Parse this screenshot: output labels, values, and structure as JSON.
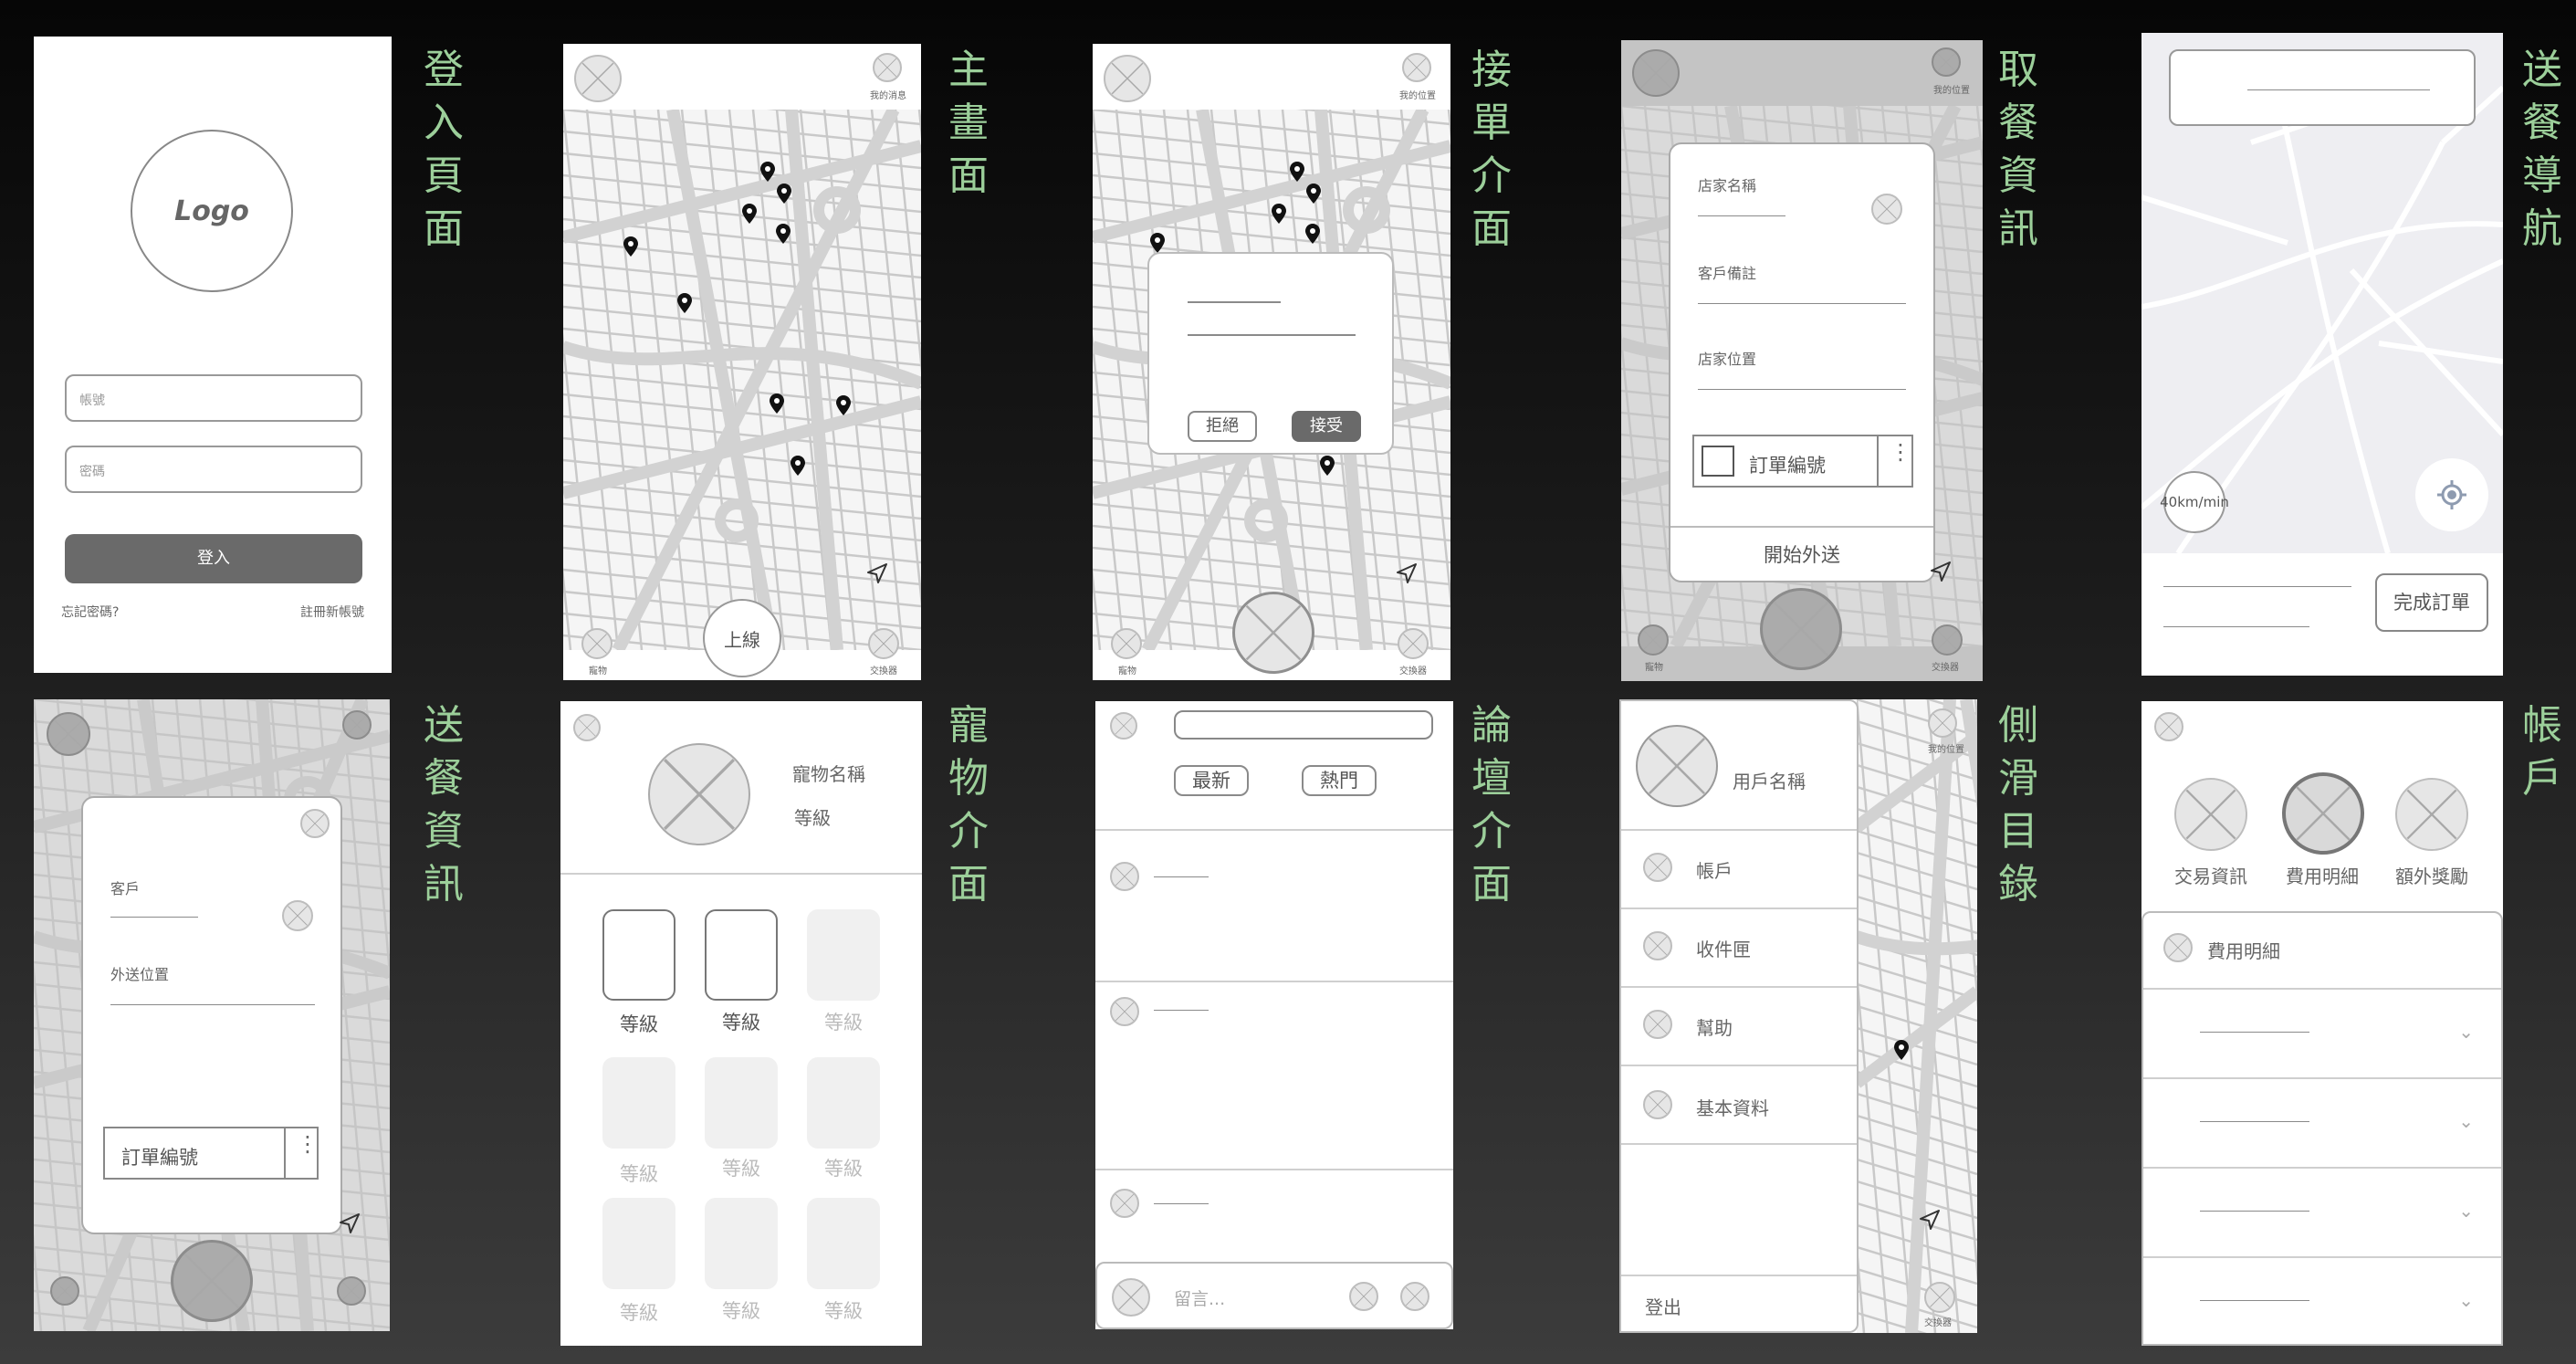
{
  "titles": {
    "login": "登入頁面",
    "main": "主畫面",
    "accept": "接單介面",
    "pickup": "取餐資訊",
    "nav": "送餐導航",
    "delivery": "送餐資訊",
    "pet": "寵物介面",
    "forum": "論壇介面",
    "sidebar": "側滑目錄",
    "account": "帳戶"
  },
  "login": {
    "logo": "Logo",
    "account_placeholder": "帳號",
    "password_placeholder": "密碼",
    "login_button": "登入",
    "forgot": "忘記密碼?",
    "register": "註冊新帳號"
  },
  "main": {
    "top_right_label": "我的消息",
    "online_button": "上線",
    "bottom_left_label": "寵物",
    "bottom_right_label": "交換器"
  },
  "accept": {
    "top_right_label": "我的位置",
    "reject_button": "拒絕",
    "accept_button": "接受",
    "bottom_left_label": "寵物",
    "bottom_right_label": "交換器"
  },
  "pickup": {
    "top_right_label": "我的位置",
    "store_name": "店家名稱",
    "customer_note": "客戶備註",
    "store_location": "店家位置",
    "order_number": "訂單編號",
    "start_button": "開始外送",
    "bottom_left_label": "寵物",
    "bottom_right_label": "交換器"
  },
  "nav": {
    "speed": "40km/min",
    "complete_button": "完成訂單"
  },
  "delivery": {
    "customer": "客戶",
    "location": "外送位置",
    "order_number": "訂單編號"
  },
  "pet": {
    "name": "寵物名稱",
    "level": "等級",
    "tiles": [
      "等級",
      "等級",
      "等級",
      "等級",
      "等級",
      "等級",
      "等級",
      "等級",
      "等級"
    ]
  },
  "forum": {
    "tab_new": "最新",
    "tab_hot": "熱門",
    "comment_placeholder": "留言..."
  },
  "sidebar": {
    "user_name": "用戶名稱",
    "items": [
      "帳戶",
      "收件匣",
      "幫助",
      "基本資料"
    ],
    "logout": "登出",
    "top_right_label": "我的位置",
    "bottom_right_label": "交換器"
  },
  "account": {
    "icons": [
      "交易資訊",
      "費用明細",
      "額外獎勵"
    ],
    "section_title": "費用明細"
  }
}
